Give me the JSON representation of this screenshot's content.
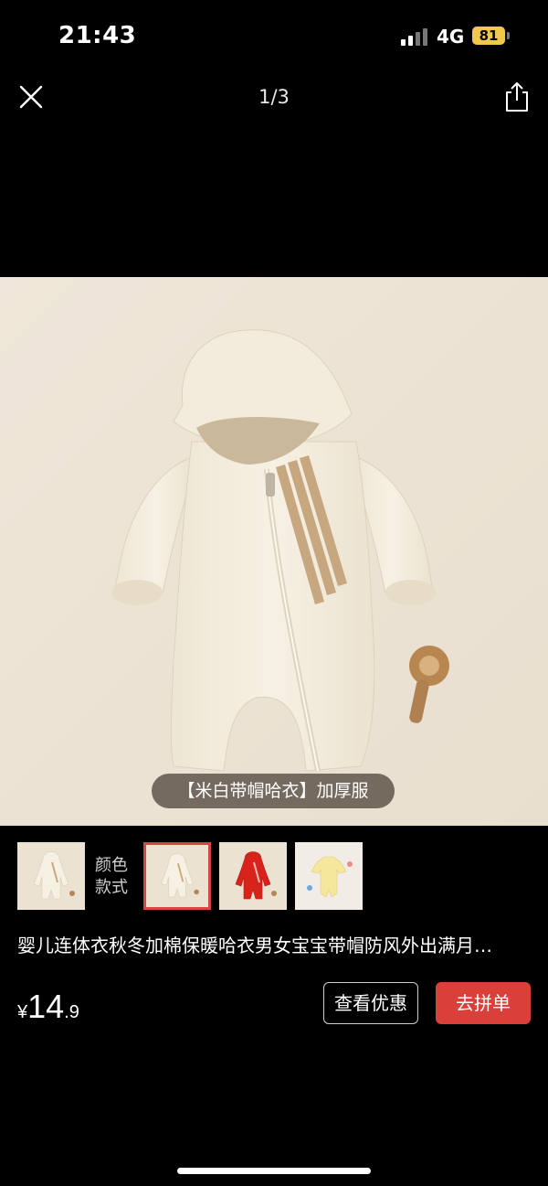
{
  "status_bar": {
    "time": "21:43",
    "network": "4G",
    "battery": "81",
    "icons": [
      "signal-icon",
      "battery-icon"
    ]
  },
  "viewer": {
    "page_indicator": "1/3",
    "icons": [
      "close-icon",
      "share-icon"
    ]
  },
  "main_image": {
    "caption": "【米白带帽哈衣】加厚服"
  },
  "variants": {
    "label_line1": "颜色",
    "label_line2": "款式",
    "thumbnails": [
      "cream-romper",
      "cream-romper-selected",
      "red-romper",
      "yellow-romper"
    ],
    "selected_index": 1
  },
  "product": {
    "title": "婴儿连体衣秋冬加棉保暖哈衣男女宝宝带帽防风外出满月…",
    "price_currency": "¥",
    "price_integer": "14",
    "price_decimal": ".9"
  },
  "actions": {
    "view_discount_label": "查看优惠",
    "group_buy_label": "去拼单"
  },
  "colors": {
    "accent_red": "#d9403a",
    "battery_yellow": "#f2c94c",
    "background": "#000000"
  }
}
